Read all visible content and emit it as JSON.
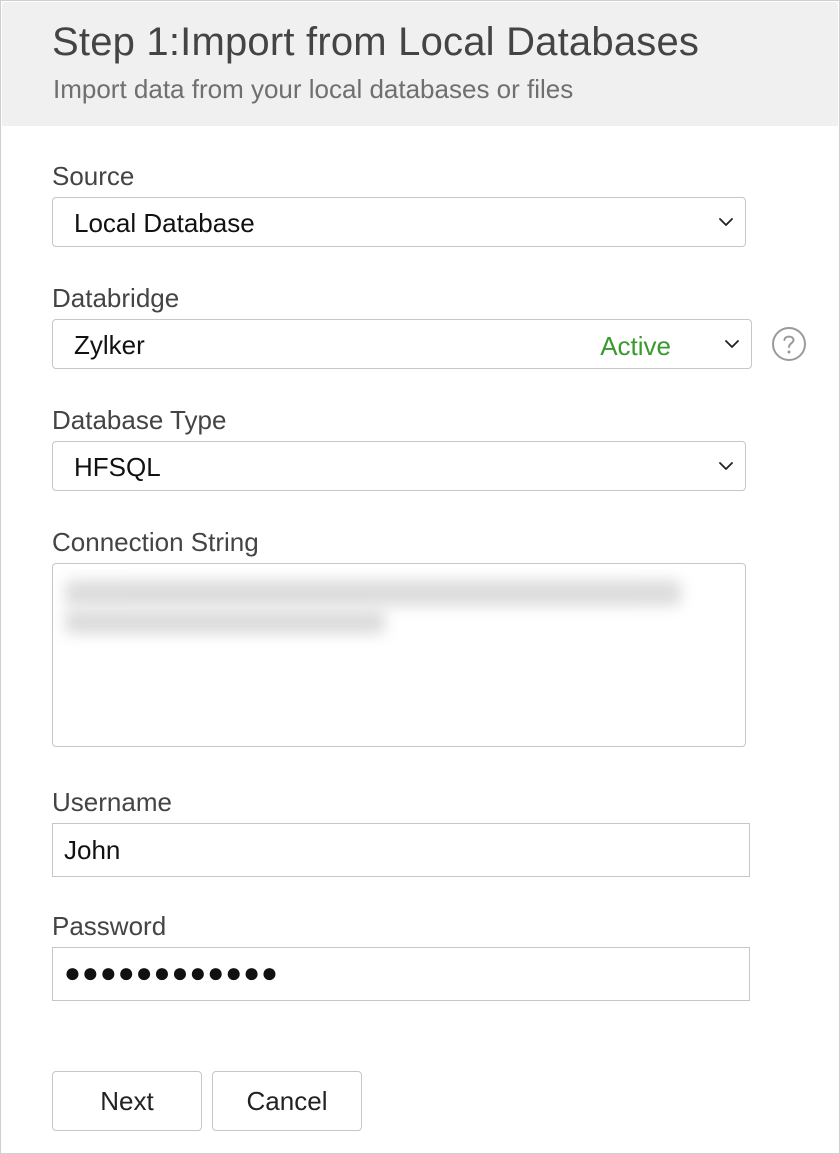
{
  "header": {
    "title": "Step 1:Import from Local Databases",
    "subtitle": "Import data from your local databases or files"
  },
  "form": {
    "source": {
      "label": "Source",
      "value": "Local Database"
    },
    "databridge": {
      "label": "Databridge",
      "value": "Zylker",
      "status": "Active",
      "status_color": "#3a9a2e"
    },
    "database_type": {
      "label": "Database Type",
      "value": "HFSQL"
    },
    "connection_string": {
      "label": "Connection String"
    },
    "username": {
      "label": "Username",
      "value": "John"
    },
    "password": {
      "label": "Password",
      "masked_value": "●●●●●●●●●●●●"
    }
  },
  "actions": {
    "next_label": "Next",
    "cancel_label": "Cancel"
  },
  "icons": {
    "select_arrow": "chevron-down-icon",
    "help": "help-circle-icon"
  }
}
